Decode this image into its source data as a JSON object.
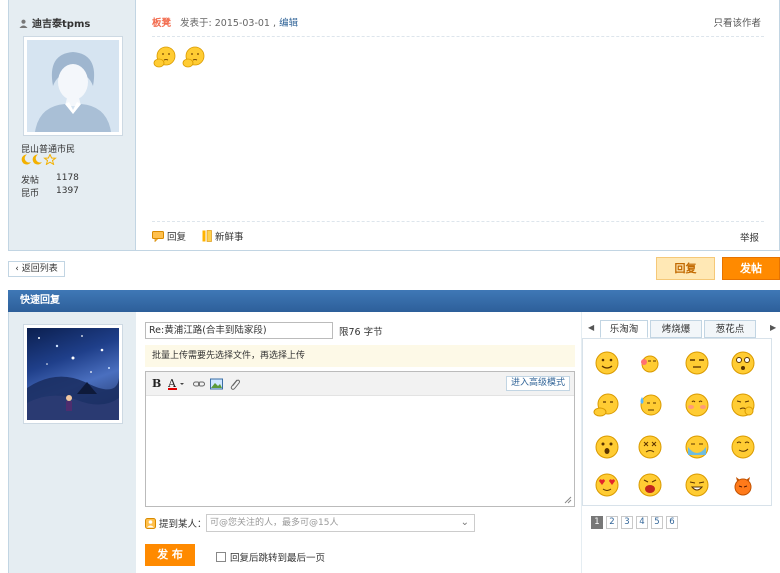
{
  "post": {
    "author": "迪吉泰tpms",
    "rank": "昆山普通市民",
    "stats": [
      {
        "label": "发帖",
        "value": "1178"
      },
      {
        "label": "昆币",
        "value": "1397"
      }
    ],
    "board": "板凳",
    "posted_label": "发表于: 2015-03-01 ,",
    "edit_label": "编辑",
    "only_author_label": "只看该作者",
    "reply_action_label": "回复",
    "fresh_action_label": "新鲜事",
    "report_label": "举报"
  },
  "nav": {
    "back_label": "‹ 返回列表",
    "reply_label": "回复",
    "new_post_label": "发帖"
  },
  "quick_reply": {
    "title": "快速回复",
    "subject_value": "Re:黄浦江路(合丰到陆家段)",
    "limit_label": "限76 字节",
    "notice": "批量上传需要先选择文件，再选择上传",
    "advanced_mode_label": "进入高级模式",
    "mention_label": "提到某人：",
    "mention_placeholder": "可@您关注的人，最多可@15人",
    "submit_label": "发 布",
    "jump_label": "回复后跳转到最后一页"
  },
  "smilies": {
    "tabs": [
      "乐淘淘",
      "烤烧爆",
      "葱花点"
    ],
    "pages": [
      "1",
      "2",
      "3",
      "4",
      "5",
      "6"
    ],
    "active_page": "1"
  },
  "colors": {
    "accent_orange": "#ff8a00",
    "header_blue": "#2d5f9a",
    "side_bg": "#e5edf2",
    "link_blue": "#336699"
  }
}
